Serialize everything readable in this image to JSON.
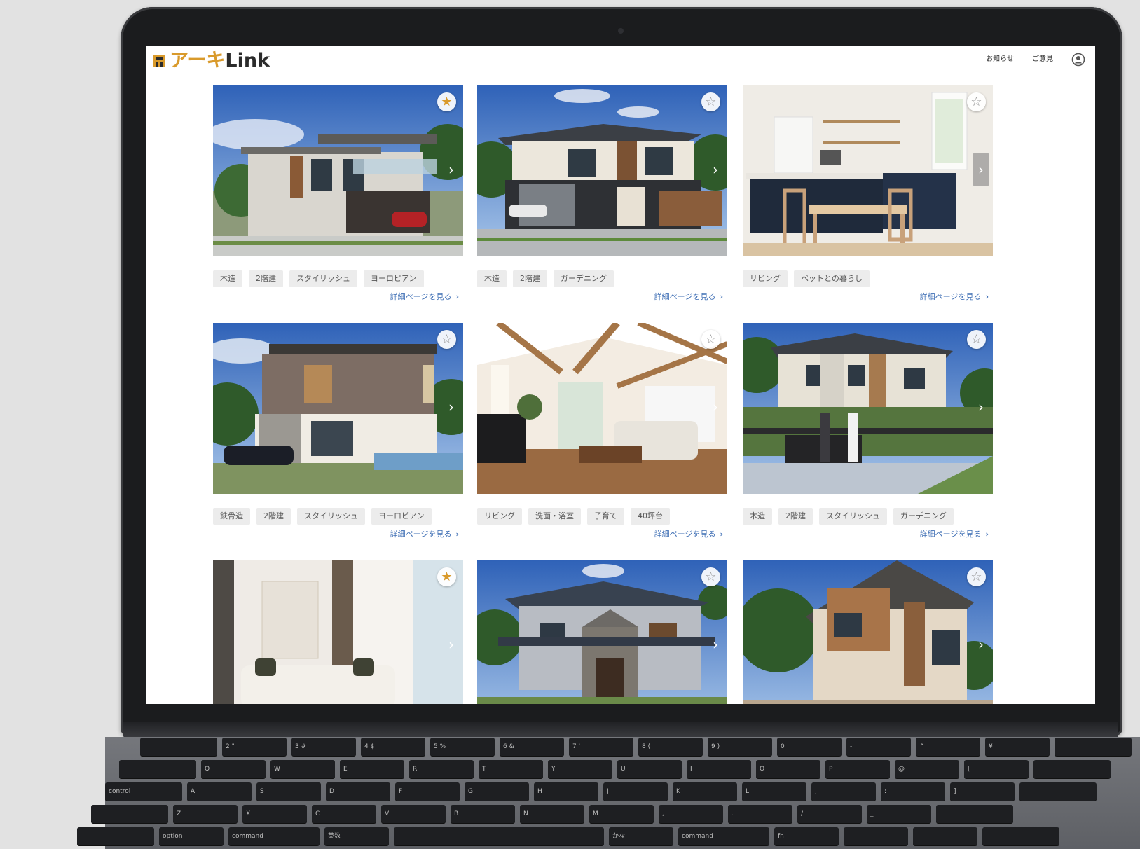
{
  "header": {
    "logo_kana": "アーキ",
    "logo_latin": "Link",
    "nav": [
      "お知らせ",
      "ご意見"
    ]
  },
  "colors": {
    "brand": "#d99a2b",
    "link": "#3f6fb5",
    "tag_bg": "#ececec"
  },
  "detail_label": "詳細ページを見る",
  "cards": [
    {
      "scene": "modern-house-carport",
      "favorite": true,
      "tags": [
        "木造",
        "2階建",
        "スタイリッシュ",
        "ヨーロピアン"
      ]
    },
    {
      "scene": "house-with-garage",
      "favorite": false,
      "tags": [
        "木造",
        "2階建",
        "ガーデニング"
      ]
    },
    {
      "scene": "kitchen-dining",
      "favorite": false,
      "tags": [
        "リビング",
        "ペットとの暮らし"
      ]
    },
    {
      "scene": "stone-house-pool",
      "favorite": false,
      "tags": [
        "鉄骨造",
        "2階建",
        "スタイリッシュ",
        "ヨーロピアン"
      ]
    },
    {
      "scene": "living-room-beams",
      "favorite": false,
      "tags": [
        "リビング",
        "洗面・浴室",
        "子育て",
        "40坪台"
      ]
    },
    {
      "scene": "house-with-fence",
      "favorite": false,
      "tags": [
        "木造",
        "2階建",
        "スタイリッシュ",
        "ガーデニング"
      ]
    },
    {
      "scene": "bright-living-room",
      "favorite": true,
      "tags": []
    },
    {
      "scene": "stone-gable-house",
      "favorite": false,
      "tags": []
    },
    {
      "scene": "wood-modern-house",
      "favorite": false,
      "tags": []
    }
  ],
  "icons": {
    "favorite_on": "star-filled-icon",
    "favorite_off": "star-outline-icon",
    "next": "chevron-right-icon",
    "user": "user-icon"
  },
  "keyboard": {
    "rows": [
      [
        "",
        "2 \"",
        "3 #",
        "4 $",
        "5 %",
        "6 &",
        "7 '",
        "8 (",
        "9 )",
        "0",
        "-",
        "^",
        "¥",
        ""
      ],
      [
        "",
        "Q",
        "W",
        "E",
        "R",
        "T",
        "Y",
        "U",
        "I",
        "O",
        "P",
        "@",
        "[",
        ""
      ],
      [
        "control",
        "A",
        "S",
        "D",
        "F",
        "G",
        "H",
        "J",
        "K",
        "L",
        ";",
        ":",
        "]",
        ""
      ],
      [
        "",
        "Z",
        "X",
        "C",
        "V",
        "B",
        "N",
        "M",
        ",",
        ".",
        "/",
        "_",
        ""
      ],
      [
        "",
        "option",
        "command",
        "英数",
        "",
        "かな",
        "command",
        "fn",
        "",
        "",
        ""
      ]
    ]
  }
}
